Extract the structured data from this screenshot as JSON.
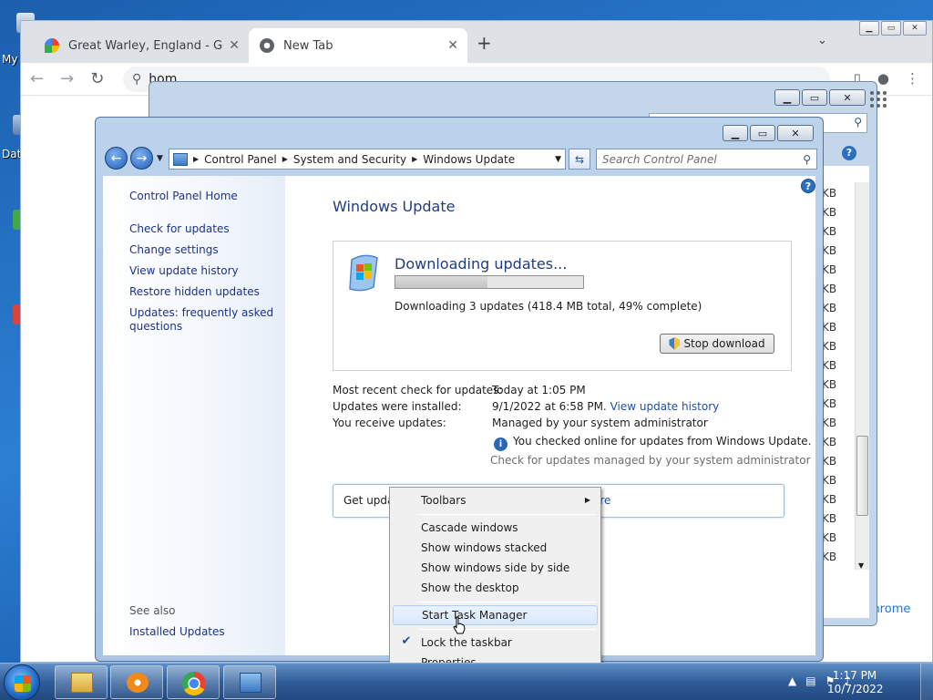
{
  "desktop": {
    "icon_labels": [
      "My",
      "Dat"
    ]
  },
  "chrome": {
    "tabs": [
      {
        "label": "Great Warley, England - Google M"
      },
      {
        "label": "New Tab"
      }
    ],
    "omnibox_value": "hom",
    "customize_label": "Customize Chrome"
  },
  "background_window": {
    "size_unit_column": [
      "KB",
      "KB",
      "KB",
      "KB",
      "KB",
      "KB",
      "KB",
      "KB",
      "KB",
      "KB",
      "KB",
      "KB",
      "KB",
      "KB",
      "KB",
      "KB",
      "KB",
      "KB",
      "KB",
      "KB"
    ]
  },
  "control_panel": {
    "breadcrumb": [
      "Control Panel",
      "System and Security",
      "Windows Update"
    ],
    "search_placeholder": "Search Control Panel",
    "left_links": [
      "Control Panel Home",
      "Check for updates",
      "Change settings",
      "View update history",
      "Restore hidden updates",
      "Updates: frequently asked",
      "questions"
    ],
    "see_also_label": "See also",
    "see_also_links": [
      "Installed Updates"
    ],
    "page_title": "Windows Update",
    "download": {
      "heading": "Downloading updates...",
      "progress_percent": 49,
      "detail": "Downloading 3 updates (418.4 MB total, 49% complete)",
      "stop_button": "Stop download"
    },
    "info": {
      "recent_check_label": "Most recent check for updates:",
      "recent_check_value": "Today at 1:05 PM",
      "installed_label": "Updates were installed:",
      "installed_value": "9/1/2022 at 6:58 PM.",
      "installed_link": "View update history",
      "receive_label": "You receive updates:",
      "receive_value": "Managed by your system administrator",
      "online_note": "You checked online for updates from Windows Update.",
      "admin_link": "Check for updates managed by your system administrator"
    },
    "get_updates_text": "Get updat",
    "get_updates_more": "ore"
  },
  "context_menu": {
    "items": [
      {
        "label": "Toolbars"
      },
      {
        "label": "Cascade windows"
      },
      {
        "label": "Show windows stacked"
      },
      {
        "label": "Show windows side by side"
      },
      {
        "label": "Show the desktop"
      },
      {
        "label": "Start Task Manager"
      },
      {
        "label": "Lock the taskbar"
      },
      {
        "label": "Properties"
      }
    ]
  },
  "taskbar": {
    "clock_time": "1:17 PM",
    "clock_date": "10/7/2022"
  },
  "colors": {
    "link": "#1f4fa8",
    "heading": "#1e3d82",
    "desktop": "#2c7fd3"
  }
}
